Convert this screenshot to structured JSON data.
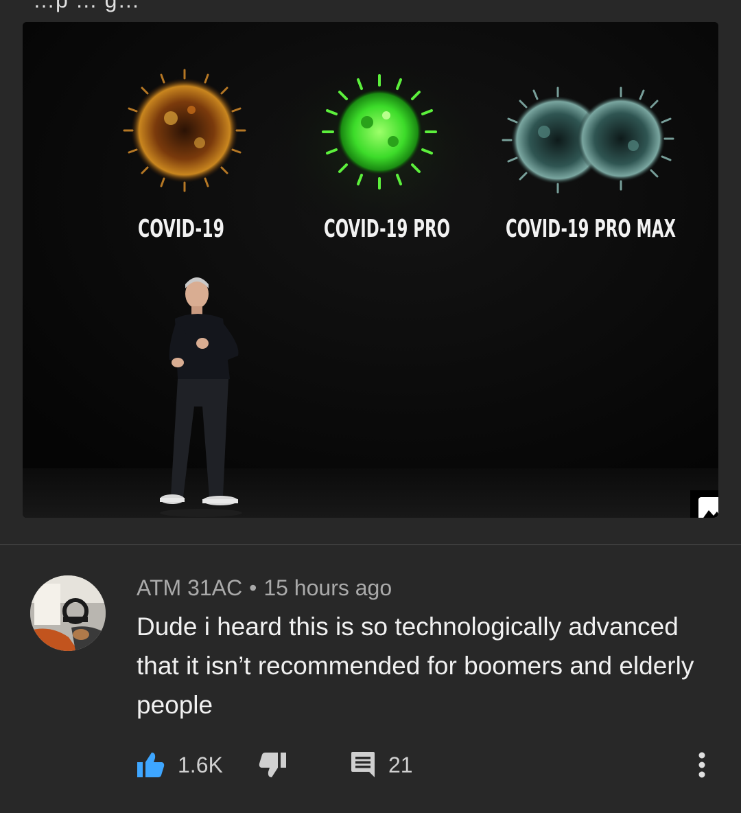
{
  "header": {
    "cut_text": "…p  … g…"
  },
  "post_image": {
    "labels": [
      "COVID-19",
      "COVID-19 PRO",
      "COVID-19 PRO MAX"
    ],
    "badge_icon": "image-icon"
  },
  "comment": {
    "author": "ATM 31AC",
    "separator": "•",
    "timestamp": "15 hours ago",
    "text": "Dude i heard this is so technologically advanced that it isn’t recommended for boomers and elderly people",
    "likes": "1.6K",
    "replies": "21"
  },
  "icons": {
    "like": "thumbs-up-icon",
    "dislike": "thumbs-down-icon",
    "reply": "comment-icon",
    "more": "more-vert-icon"
  },
  "colors": {
    "background": "#282828",
    "like_active": "#3ea6ff",
    "secondary_text": "#aaaaaa"
  }
}
